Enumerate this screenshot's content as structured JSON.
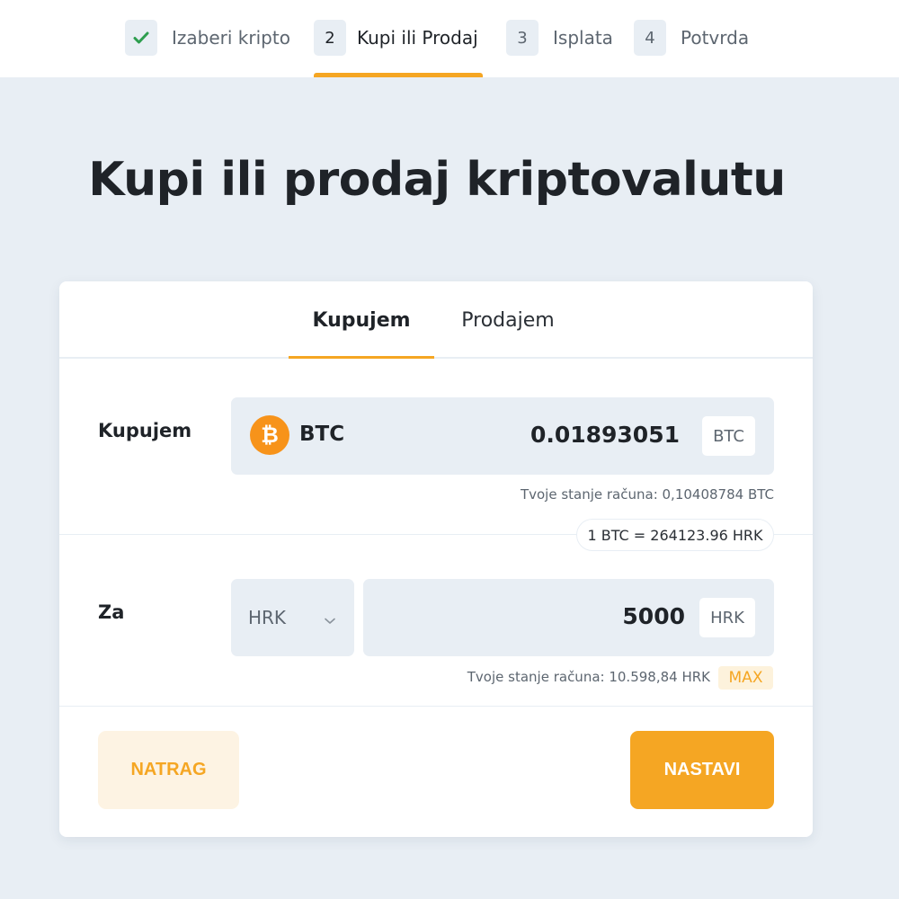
{
  "stepper": {
    "steps": [
      {
        "badge": "",
        "label": "Izaberi kripto",
        "state": "done"
      },
      {
        "badge": "2",
        "label": "Kupi ili Prodaj",
        "state": "active"
      },
      {
        "badge": "3",
        "label": "Isplata",
        "state": "pending"
      },
      {
        "badge": "4",
        "label": "Potvrda",
        "state": "pending"
      }
    ]
  },
  "page": {
    "title": "Kupi ili prodaj kriptovalutu"
  },
  "tabs": {
    "buy": "Kupujem",
    "sell": "Prodajem",
    "selected": "buy"
  },
  "buy_row": {
    "label": "Kupujem",
    "coin_icon": "bitcoin-icon",
    "coin_symbol": "₿",
    "coin": "BTC",
    "amount": "0.01893051",
    "unit": "BTC",
    "balance": "Tvoje stanje računa: 0,10408784 BTC"
  },
  "rate": "1 BTC = 264123.96 HRK",
  "pay_row": {
    "label": "Za",
    "currency": "HRK",
    "amount": "5000",
    "unit": "HRK",
    "balance": "Tvoje stanje računa: 10.598,84 HRK",
    "max": "MAX"
  },
  "actions": {
    "back": "NATRAG",
    "next": "NASTAVI"
  },
  "colors": {
    "accent": "#f5a623",
    "background": "#e8eef4",
    "bitcoin": "#f7931a",
    "check": "#2e9e4f"
  }
}
